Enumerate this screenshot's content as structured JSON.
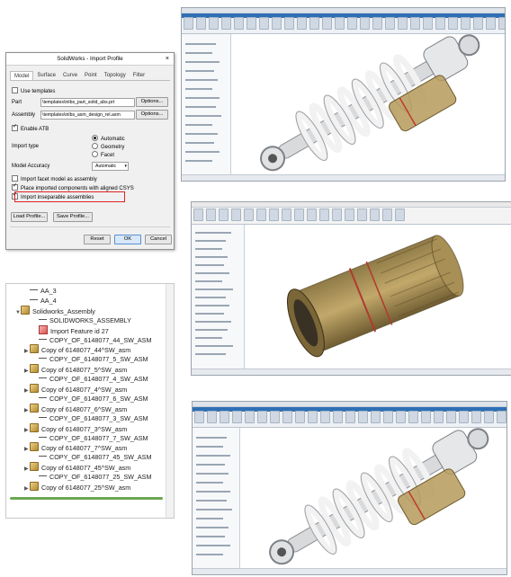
{
  "dialog": {
    "title": "SolidWorks - Import Profile",
    "close": "×",
    "tabs": [
      "Model",
      "Surface",
      "Curve",
      "Point",
      "Topology",
      "Filter"
    ],
    "use_templates": "Use templates",
    "part_label": "Part",
    "part_value": "\\templates\\inlbs_part_solid_abs.prt",
    "assembly_label": "Assembly",
    "assembly_value": "\\templates\\inlbs_asm_design_rel.asm",
    "options": "Options...",
    "enable_atb": "Enable ATB",
    "import_type": "Import type",
    "radio_automatic": "Automatic",
    "radio_geometry": "Geometry",
    "radio_facet": "Facet",
    "model_accuracy": "Model Accuracy",
    "accuracy_value": "Automatic",
    "facet_assembly": "Import facet model as assembly",
    "aligned_csys": "Place imported components with aligned CSYS",
    "inseparable": "Import inseparable assemblies",
    "load_profile": "Load Profile...",
    "save_profile": "Save Profile...",
    "reset": "Reset",
    "ok": "OK",
    "cancel": "Cancel"
  },
  "tree": {
    "items": [
      {
        "label": "AA_3",
        "indent": 1,
        "icon": "line",
        "expand": ""
      },
      {
        "label": "AA_4",
        "indent": 1,
        "icon": "line",
        "expand": ""
      },
      {
        "label": "Solidworks_Assembly",
        "indent": 0,
        "icon": "asm",
        "expand": "▼"
      },
      {
        "label": "SOLIDWORKS_ASSEMBLY",
        "indent": 2,
        "icon": "line",
        "expand": ""
      },
      {
        "label": "Import Feature id 27",
        "indent": 2,
        "icon": "feat",
        "expand": ""
      },
      {
        "label": "COPY_OF_6148077_44_SW_ASM",
        "indent": 2,
        "icon": "line",
        "expand": ""
      },
      {
        "label": "Copy of 6148077_44^SW_asm",
        "indent": 1,
        "icon": "asm",
        "expand": "▶"
      },
      {
        "label": "COPY_OF_6148077_5_SW_ASM",
        "indent": 2,
        "icon": "line",
        "expand": ""
      },
      {
        "label": "Copy of 6148077_5^SW_asm",
        "indent": 1,
        "icon": "asm",
        "expand": "▶"
      },
      {
        "label": "COPY_OF_6148077_4_SW_ASM",
        "indent": 2,
        "icon": "line",
        "expand": ""
      },
      {
        "label": "Copy of 6148077_4^SW_asm",
        "indent": 1,
        "icon": "asm",
        "expand": "▶"
      },
      {
        "label": "COPY_OF_6148077_6_SW_ASM",
        "indent": 2,
        "icon": "line",
        "expand": ""
      },
      {
        "label": "Copy of 6148077_6^SW_asm",
        "indent": 1,
        "icon": "asm",
        "expand": "▶"
      },
      {
        "label": "COPY_OF_6148077_3_SW_ASM",
        "indent": 2,
        "icon": "line",
        "expand": ""
      },
      {
        "label": "Copy of 6148077_3^SW_asm",
        "indent": 1,
        "icon": "asm",
        "expand": "▶"
      },
      {
        "label": "COPY_OF_6148077_7_SW_ASM",
        "indent": 2,
        "icon": "line",
        "expand": ""
      },
      {
        "label": "Copy of 6148077_7^SW_asm",
        "indent": 1,
        "icon": "asm",
        "expand": "▶"
      },
      {
        "label": "COPY_OF_6148077_45_SW_ASM",
        "indent": 2,
        "icon": "line",
        "expand": ""
      },
      {
        "label": "Copy of 6148077_45^SW_asm",
        "indent": 1,
        "icon": "asm",
        "expand": "▶"
      },
      {
        "label": "COPY_OF_6148077_25_SW_ASM",
        "indent": 2,
        "icon": "line",
        "expand": ""
      },
      {
        "label": "Copy of 6148077_25^SW_asm",
        "indent": 1,
        "icon": "asm",
        "expand": "▶"
      }
    ]
  },
  "colors": {
    "spring": "#e7e7e7",
    "damper_body": "#b59a5a",
    "chrome": "#d8dadc",
    "red_ring": "#c0392b"
  }
}
